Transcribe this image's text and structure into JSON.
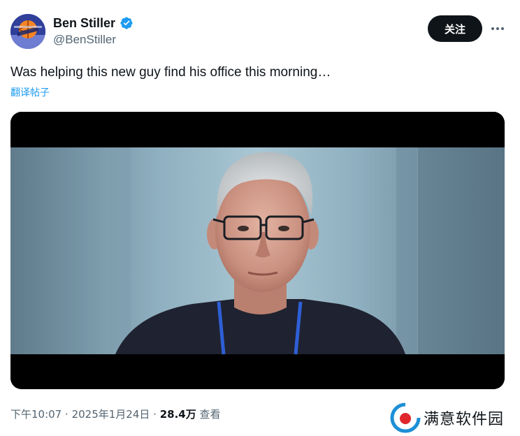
{
  "author": {
    "display_name": "Ben Stiller",
    "handle": "@BenStiller",
    "verified": true,
    "avatar_icon": "knicks-logo-icon"
  },
  "actions": {
    "follow_label": "关注",
    "more_icon": "more-horizontal-icon"
  },
  "tweet": {
    "text": "Was helping this new guy find his office this morning…",
    "translate_label": "翻译帖子"
  },
  "meta": {
    "time": "下午10:07",
    "separator": "·",
    "date": "2025年1月24日",
    "views_count": "28.4万",
    "views_label": "查看"
  },
  "watermark": {
    "text": "满意软件园",
    "icon": "watermark-logo-icon"
  },
  "colors": {
    "verified_blue": "#1d9bf0",
    "link_blue": "#1d9bf0",
    "secondary_text": "#536471",
    "primary_text": "#0f1419"
  }
}
